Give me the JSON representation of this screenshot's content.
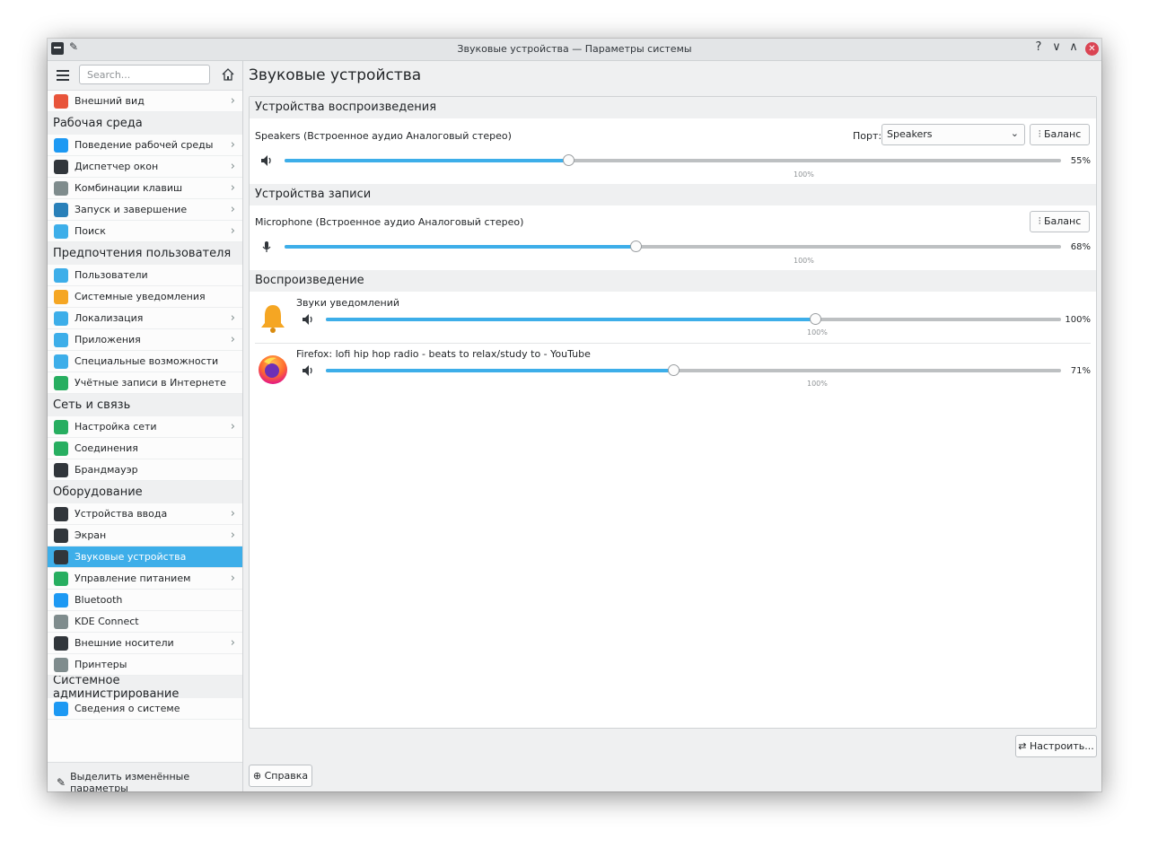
{
  "window": {
    "title": "Звуковые устройства — Параметры системы"
  },
  "titlebar": {
    "help": "?",
    "minimize": "∨",
    "maximize": "∧",
    "close": "✕"
  },
  "sidebar": {
    "search_placeholder": "Search...",
    "highlight_label": "Выделить изменённые параметры",
    "rows": [
      {
        "kind": "item",
        "label": "Внешний вид",
        "icon": "appearance-icon",
        "color": "#e8543a",
        "chevron": true
      },
      {
        "kind": "cat",
        "label": "Рабочая среда"
      },
      {
        "kind": "item",
        "label": "Поведение рабочей среды",
        "icon": "workspace-behavior-icon",
        "color": "#1d99f3",
        "chevron": true
      },
      {
        "kind": "item",
        "label": "Диспетчер окон",
        "icon": "window-manager-icon",
        "color": "#31363b",
        "chevron": true
      },
      {
        "kind": "item",
        "label": "Комбинации клавиш",
        "icon": "keyboard-icon",
        "color": "#7f8c8d",
        "chevron": true
      },
      {
        "kind": "item",
        "label": "Запуск и завершение",
        "icon": "startup-icon",
        "color": "#2980b9",
        "chevron": true
      },
      {
        "kind": "item",
        "label": "Поиск",
        "icon": "search-icon",
        "color": "#3daee9",
        "chevron": true
      },
      {
        "kind": "cat",
        "label": "Предпочтения пользователя"
      },
      {
        "kind": "item",
        "label": "Пользователи",
        "icon": "users-icon",
        "color": "#3daee9",
        "chevron": false
      },
      {
        "kind": "item",
        "label": "Системные уведомления",
        "icon": "bell-icon",
        "color": "#f5a623",
        "chevron": false
      },
      {
        "kind": "item",
        "label": "Локализация",
        "icon": "localization-icon",
        "color": "#3daee9",
        "chevron": true
      },
      {
        "kind": "item",
        "label": "Приложения",
        "icon": "applications-icon",
        "color": "#3daee9",
        "chevron": true
      },
      {
        "kind": "item",
        "label": "Специальные возможности",
        "icon": "accessibility-icon",
        "color": "#3daee9",
        "chevron": false
      },
      {
        "kind": "item",
        "label": "Учётные записи в Интернете",
        "icon": "online-accounts-icon",
        "color": "#27ae60",
        "chevron": false
      },
      {
        "kind": "cat",
        "label": "Сеть и связь"
      },
      {
        "kind": "item",
        "label": "Настройка сети",
        "icon": "network-settings-icon",
        "color": "#27ae60",
        "chevron": true
      },
      {
        "kind": "item",
        "label": "Соединения",
        "icon": "connections-icon",
        "color": "#27ae60",
        "chevron": false
      },
      {
        "kind": "item",
        "label": "Брандмауэр",
        "icon": "firewall-icon",
        "color": "#31363b",
        "chevron": false
      },
      {
        "kind": "cat",
        "label": "Оборудование"
      },
      {
        "kind": "item",
        "label": "Устройства ввода",
        "icon": "input-devices-icon",
        "color": "#31363b",
        "chevron": true
      },
      {
        "kind": "item",
        "label": "Экран",
        "icon": "display-icon",
        "color": "#31363b",
        "chevron": true
      },
      {
        "kind": "item",
        "label": "Звуковые устройства",
        "icon": "audio-devices-icon",
        "color": "#31363b",
        "chevron": false,
        "active": true
      },
      {
        "kind": "item",
        "label": "Управление питанием",
        "icon": "power-icon",
        "color": "#27ae60",
        "chevron": true
      },
      {
        "kind": "item",
        "label": "Bluetooth",
        "icon": "bluetooth-icon",
        "color": "#1d99f3",
        "chevron": false
      },
      {
        "kind": "item",
        "label": "KDE Connect",
        "icon": "kde-connect-icon",
        "color": "#7f8c8d",
        "chevron": false
      },
      {
        "kind": "item",
        "label": "Внешние носители",
        "icon": "removable-storage-icon",
        "color": "#31363b",
        "chevron": true
      },
      {
        "kind": "item",
        "label": "Принтеры",
        "icon": "printer-icon",
        "color": "#7f8c8d",
        "chevron": false
      },
      {
        "kind": "cat",
        "label": "Системное администрирование"
      },
      {
        "kind": "item",
        "label": "Сведения о системе",
        "icon": "info-icon",
        "color": "#1d99f3",
        "chevron": false
      }
    ]
  },
  "main": {
    "title": "Звуковые устройства",
    "playback_devices": {
      "header": "Устройства воспроизведения",
      "device": "Speakers (Встроенное аудио Аналоговый стерео)",
      "port_label": "Порт:",
      "port_value": "Speakers",
      "balance_label": "Баланс",
      "volume_pct": 55,
      "volume_text": "55%",
      "mark_100": "100%"
    },
    "recording_devices": {
      "header": "Устройства записи",
      "device": "Microphone (Встроенное аудио Аналоговый стерео)",
      "balance_label": "Баланс",
      "volume_pct": 68,
      "volume_text": "68%",
      "mark_100": "100%"
    },
    "playback_streams": {
      "header": "Воспроизведение",
      "streams": [
        {
          "name": "Звуки уведомлений",
          "volume_pct": 100,
          "volume_text": "100%",
          "mark_100": "100%"
        },
        {
          "name": "Firefox: lofi hip hop radio - beats to relax/study to - YouTube",
          "volume_pct": 71,
          "volume_text": "71%",
          "mark_100": "100%"
        }
      ]
    },
    "configure_label": "Настроить...",
    "help_label": "Справка"
  }
}
